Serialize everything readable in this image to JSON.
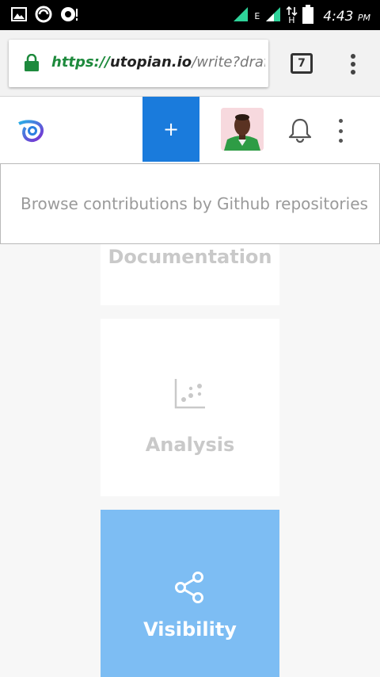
{
  "status_bar": {
    "time": "4:43",
    "ampm": "PM",
    "network_label": "E",
    "data_label": "H",
    "icons": [
      "image-icon",
      "sync-icon",
      "camera-icon",
      "signal-icon",
      "battery-icon"
    ]
  },
  "browser": {
    "url_scheme": "https://",
    "url_host": "utopian.io",
    "url_path": "/write?draf",
    "tab_count": "7",
    "accent_secure": "#1e8a3d"
  },
  "header": {
    "plus_label": "+",
    "accent": "#1a7bdc"
  },
  "search": {
    "placeholder": "Browse contributions by Github repositories"
  },
  "categories": [
    {
      "label": "Documentation",
      "icon": "document-icon",
      "selected": false
    },
    {
      "label": "Analysis",
      "icon": "scatter-chart-icon",
      "selected": false
    },
    {
      "label": "Visibility",
      "icon": "share-icon",
      "selected": true,
      "color": "#7dbdf3"
    }
  ]
}
